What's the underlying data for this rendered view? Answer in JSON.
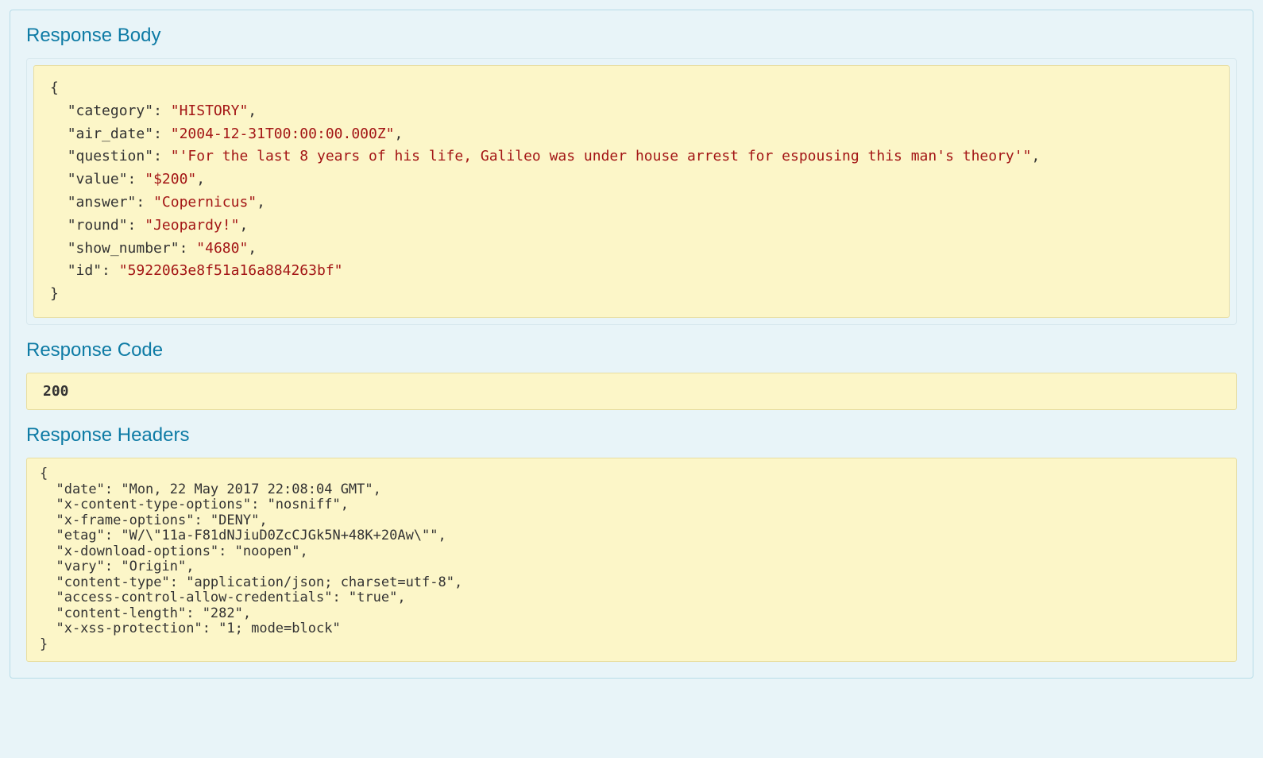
{
  "sections": {
    "response_body_title": "Response Body",
    "response_code_title": "Response Code",
    "response_headers_title": "Response Headers"
  },
  "response_body": {
    "category": "HISTORY",
    "air_date": "2004-12-31T00:00:00.000Z",
    "question": "'For the last 8 years of his life, Galileo was under house arrest for espousing this man's theory'",
    "value": "$200",
    "answer": "Copernicus",
    "round": "Jeopardy!",
    "show_number": "4680",
    "id": "5922063e8f51a16a884263bf"
  },
  "response_code": "200",
  "response_headers": {
    "date": "Mon, 22 May 2017 22:08:04 GMT",
    "x-content-type-options": "nosniff",
    "x-frame-options": "DENY",
    "etag": "W/\"11a-F81dNJiuD0ZcCJGk5N+48K+20Aw\"",
    "x-download-options": "noopen",
    "vary": "Origin",
    "content-type": "application/json; charset=utf-8",
    "access-control-allow-credentials": "true",
    "content-length": "282",
    "x-xss-protection": "1; mode=block"
  }
}
